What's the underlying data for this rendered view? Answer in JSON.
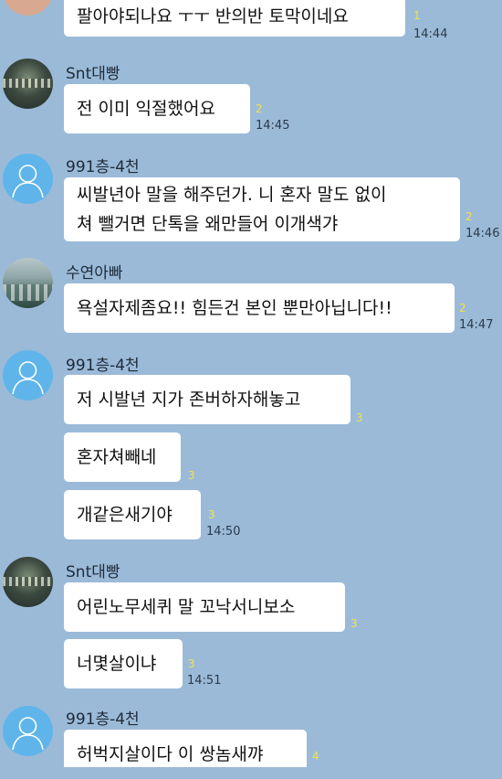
{
  "messages": [
    {
      "sender": "",
      "text": "팔아야되나요 ㅜㅜ 반의반 토막이네요",
      "unread": "1",
      "time": "14:44"
    },
    {
      "sender": "Snt대빵",
      "text": "전 이미 익절했어요",
      "unread": "2",
      "time": "14:45"
    },
    {
      "sender": "991층-4천",
      "text_lines": [
        "씨발년아 말을 해주던가. 니 혼자 말도 없이",
        "쳐 뺄거면 단톡을 왜만들어 이개색갸"
      ],
      "unread": "2",
      "time": "14:46"
    },
    {
      "sender": "수연아빠",
      "text": "욕설자제좀요!!  힘든건 본인 뿐만아닙니다!!",
      "unread": "2",
      "time": "14:47"
    },
    {
      "sender": "991층-4천",
      "text": "저 시발년 지가 존버하자해놓고",
      "unread": "3",
      "time": ""
    },
    {
      "sender": "",
      "text": "혼자쳐빼네",
      "unread": "3",
      "time": ""
    },
    {
      "sender": "",
      "text": "개같은새기야",
      "unread": "3",
      "time": "14:50"
    },
    {
      "sender": "Snt대빵",
      "text": "어린노무세퀴 말 꼬낙서니보소",
      "unread": "3",
      "time": ""
    },
    {
      "sender": "",
      "text": "너몇살이냐",
      "unread": "3",
      "time": "14:51"
    },
    {
      "sender": "991층-4천",
      "text": "허벅지살이다 이 쌍놈새꺄",
      "unread": "4",
      "time": ""
    }
  ],
  "icons": {
    "default_avatar": "person-silhouette-icon"
  }
}
